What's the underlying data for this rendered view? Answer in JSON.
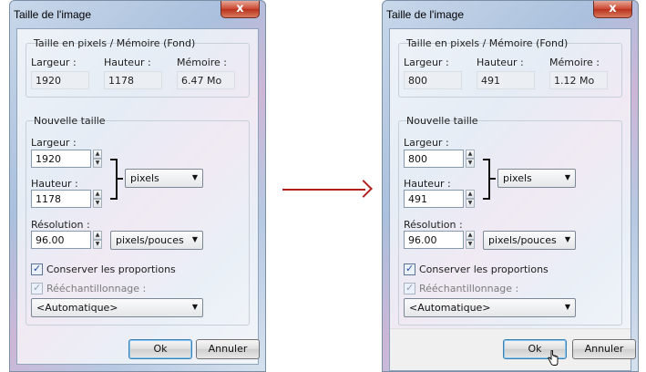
{
  "dialog_title": "Taille de l'image",
  "close_glyph": "x",
  "groups": {
    "memory_title": "Taille en pixels / Mémoire (Fond)",
    "new_size_title": "Nouvelle taille"
  },
  "labels": {
    "largeur_top": "Largeur :",
    "hauteur_top": "Hauteur :",
    "memoire_top": "Mémoire :",
    "largeur": "Largeur :",
    "hauteur": "Hauteur :",
    "resolution": "Résolution :"
  },
  "left": {
    "width": "1920",
    "height": "1178",
    "memory": "6.47 Mo",
    "width_input": "1920",
    "height_input": "1178",
    "resolution_input": "96.00"
  },
  "right": {
    "width": "800",
    "height": "491",
    "memory": "1.12 Mo",
    "width_input": "800",
    "height_input": "491",
    "resolution_input": "96.00"
  },
  "units_select": "pixels",
  "resolution_unit_select": "pixels/pouces",
  "keep_proportions_label": "Conserver les proportions",
  "resample_label": "Rééchantillonnage :",
  "resample_select": "<Automatique>",
  "ok_button": "Ok",
  "cancel_button": "Annuler",
  "colors": {
    "arrow": "#b31f1f",
    "close_button": "#c9452f"
  }
}
